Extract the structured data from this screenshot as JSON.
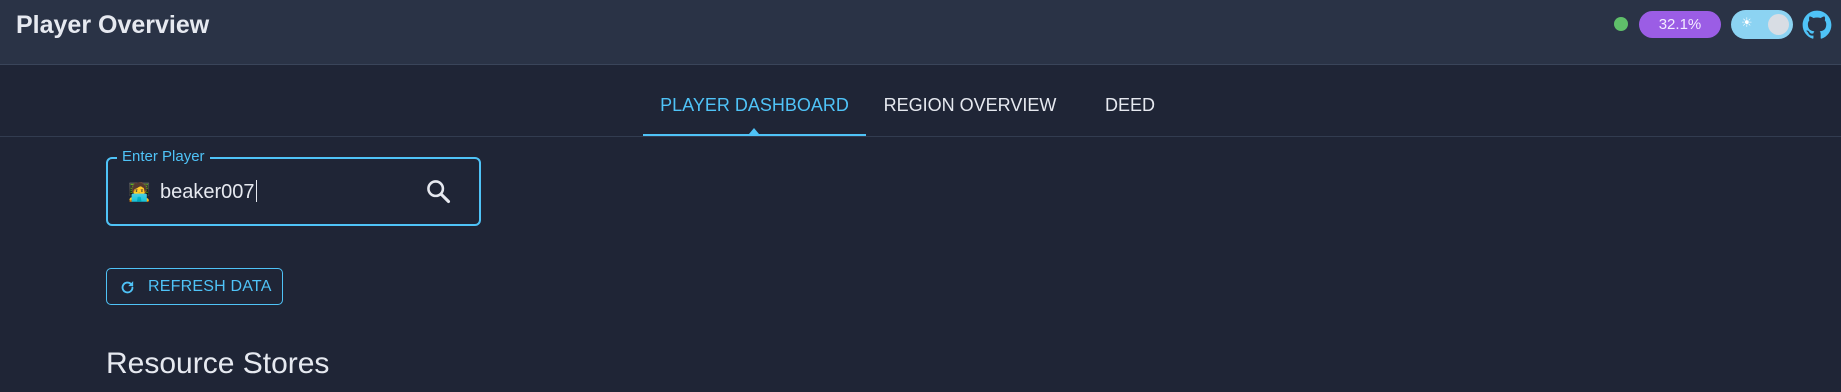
{
  "header": {
    "title": "Player Overview",
    "status_color": "#5fbf6a",
    "percent_badge": "32.1%",
    "theme_toggle": {
      "sun_icon": "☀",
      "state": "light-mode-off"
    },
    "github_icon": "github-icon"
  },
  "tabs": [
    {
      "label": "PLAYER DASHBOARD",
      "active": true
    },
    {
      "label": "REGION OVERVIEW",
      "active": false
    },
    {
      "label": "DEED",
      "active": false
    }
  ],
  "player_input": {
    "label": "Enter Player",
    "emoji": "🧑‍💻",
    "value": "beaker007",
    "search_icon": "search-icon"
  },
  "refresh": {
    "label": "REFRESH DATA",
    "icon": "refresh-icon"
  },
  "section": {
    "title": "Resource Stores"
  },
  "colors": {
    "accent": "#4fc3f7",
    "badge": "#9b5de5",
    "background": "#1f2536",
    "appbar": "#2a3346"
  }
}
